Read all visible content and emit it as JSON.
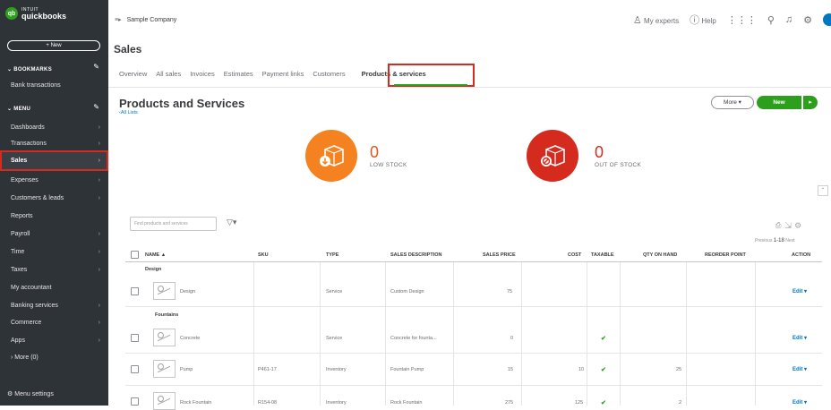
{
  "sidebar": {
    "logo_line1": "INTUIT",
    "logo_line2": "quickbooks",
    "logo_badge": "qb",
    "new_label": "+ New",
    "bookmarks_label": "BOOKMARKS",
    "bookmarks": [
      {
        "label": "Bank transactions"
      }
    ],
    "menu_label": "MENU",
    "items": [
      {
        "label": "Dashboards"
      },
      {
        "label": "Transactions"
      },
      {
        "label": "Sales"
      },
      {
        "label": "Expenses"
      },
      {
        "label": "Customers & leads"
      },
      {
        "label": "Reports"
      },
      {
        "label": "Payroll"
      },
      {
        "label": "Time"
      },
      {
        "label": "Taxes"
      },
      {
        "label": "My accountant"
      },
      {
        "label": "Banking services"
      },
      {
        "label": "Commerce"
      },
      {
        "label": "Apps"
      },
      {
        "label": "More (0)"
      }
    ],
    "menu_settings": "Menu settings"
  },
  "header": {
    "company": "Sample Company",
    "my_experts": "My experts",
    "help": "Help"
  },
  "page_title": "Sales",
  "tabs": [
    {
      "label": "Overview"
    },
    {
      "label": "All sales"
    },
    {
      "label": "Invoices"
    },
    {
      "label": "Estimates"
    },
    {
      "label": "Payment links"
    },
    {
      "label": "Customers"
    },
    {
      "label": "Products & services"
    }
  ],
  "main": {
    "title": "Products and Services",
    "all_lists": "All Lists",
    "more_label": "More",
    "new_label": "New"
  },
  "stats": {
    "low_stock_count": "0",
    "low_stock_label": "LOW STOCK",
    "out_stock_count": "0",
    "out_stock_label": "OUT OF STOCK"
  },
  "toolbar": {
    "search_placeholder": "Find products and services",
    "pager_prev": "Previous",
    "pager_range": "1-18",
    "pager_next": "Next"
  },
  "table": {
    "headers": {
      "name": "NAME ▲",
      "sku": "SKU",
      "type": "TYPE",
      "sales_description": "SALES DESCRIPTION",
      "sales_price": "SALES PRICE",
      "cost": "COST",
      "taxable": "TAXABLE",
      "qty_on_hand": "QTY ON HAND",
      "reorder_point": "REORDER POINT",
      "action": "ACTION"
    },
    "group1": "Design",
    "group2": "Fountains",
    "rows": [
      {
        "name": "Design",
        "sku": "",
        "type": "Service",
        "desc": "Custom Design",
        "price": "75",
        "cost": "",
        "taxable": "",
        "qty": "",
        "reorder": "",
        "action": "Edit"
      },
      {
        "name": "Concrete",
        "sku": "",
        "type": "Service",
        "desc": "Concrete for founta...",
        "price": "0",
        "cost": "",
        "taxable": "✔",
        "qty": "",
        "reorder": "",
        "action": "Edit"
      },
      {
        "name": "Pump",
        "sku": "P461-17",
        "type": "Inventory",
        "desc": "Fountain Pump",
        "price": "15",
        "cost": "10",
        "taxable": "✔",
        "qty": "25",
        "reorder": "",
        "action": "Edit"
      },
      {
        "name": "Rock Fountain",
        "sku": "R154-08",
        "type": "Inventory",
        "desc": "Rock Fountain",
        "price": "275",
        "cost": "125",
        "taxable": "✔",
        "qty": "2",
        "reorder": "",
        "action": "Edit"
      }
    ]
  }
}
